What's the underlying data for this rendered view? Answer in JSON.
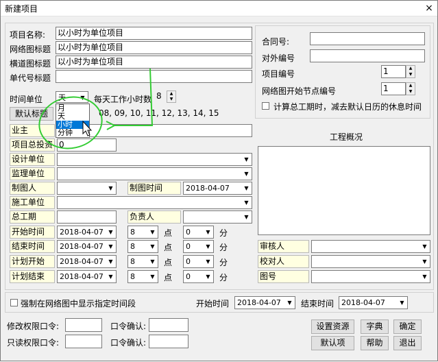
{
  "window": {
    "title": "新建项目",
    "close": "×"
  },
  "project": {
    "name_label": "项目名称:",
    "name_value": "以小时为单位项目",
    "network_title_label": "网络图标题",
    "network_title_value": "以小时为单位项目",
    "gantt_title_label": "横道图标题",
    "gantt_title_value": "以小时为单位项目",
    "code_title_label": "单代号标题",
    "code_title_value": ""
  },
  "time": {
    "unit_label": "时间单位",
    "unit_value": "天",
    "daily_hours_label": "每天工作小时数",
    "daily_hours_value": "8",
    "default_title_button": "默认标题",
    "hours_list": "08, 09, 10, 11, 12, 13, 14, 15",
    "unit_options": [
      "月",
      "天",
      "小时",
      "分钟"
    ],
    "unit_selected_option": "小时"
  },
  "fields": {
    "owner": "业主",
    "investment_label": "项目总投资",
    "investment_value": "0",
    "design_unit": "设计单位",
    "supervision_unit": "监理单位",
    "drafter": "制图人",
    "draft_time_label": "制图时间",
    "draft_time_value": "2018-04-07",
    "construction_unit": "施工单位",
    "total_duration": "总工期",
    "responsible": "负责人",
    "start_time": "开始时间",
    "end_time": "结束时间",
    "plan_start": "计划开始",
    "plan_end": "计划结束",
    "date_value": "2018-04-07",
    "hour_value": "8",
    "minute_value": "0",
    "point_label": "点",
    "minute_label": "分"
  },
  "right": {
    "contract_label": "合同号:",
    "external_label": "对外编号",
    "project_no_label": "项目编号",
    "project_no_value": "1",
    "start_node_label": "网络图开始节点编号",
    "start_node_value": "1",
    "rest_check_label": "计算总工期时，减去默认日历的休息时间",
    "overview_label": "工程概况",
    "reviewer_label": "审核人",
    "checker_label": "校对人",
    "drawing_no_label": "图号"
  },
  "bottom": {
    "force_label": "强制在网络图中显示指定时间段",
    "start_label": "开始时间",
    "start_value": "2018-04-07",
    "end_label": "结束时间",
    "end_value": "2018-04-07",
    "modify_pwd_label": "修改权限口令:",
    "readonly_pwd_label": "只读权限口令:",
    "confirm_label": "口令确认:",
    "set_resource": "设置资源",
    "dictionary": "字典",
    "ok": "确定",
    "default": "默认项",
    "help": "帮助",
    "exit": "退出"
  },
  "colors": {
    "label_bg": "#ffffe1",
    "annotation": "#33cc33",
    "selection": "#0078d7"
  }
}
